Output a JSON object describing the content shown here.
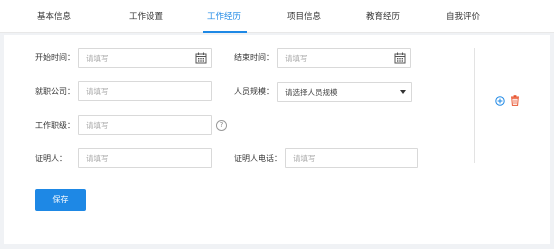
{
  "tabs": [
    {
      "label": "基本信息"
    },
    {
      "label": "工作设置"
    },
    {
      "label": "工作经历"
    },
    {
      "label": "项目信息"
    },
    {
      "label": "教育经历"
    },
    {
      "label": "自我评价"
    }
  ],
  "form": {
    "start_time": {
      "label": "开始时间：",
      "placeholder": "请填写"
    },
    "end_time": {
      "label": "结束时间：",
      "placeholder": "请填写"
    },
    "company": {
      "label": "就职公司：",
      "placeholder": "请填写"
    },
    "staff_size": {
      "label": "人员规模：",
      "value": "请选择人员规模"
    },
    "job_level": {
      "label": "工作职级：",
      "placeholder": "请填写",
      "help": "?"
    },
    "reference": {
      "label": "证明人：",
      "placeholder": "请填写"
    },
    "reference_phone": {
      "label": "证明人电话：",
      "placeholder": "请填写"
    }
  },
  "save_label": "保存",
  "colors": {
    "accent": "#1e88e5",
    "delete": "#e8542f"
  }
}
